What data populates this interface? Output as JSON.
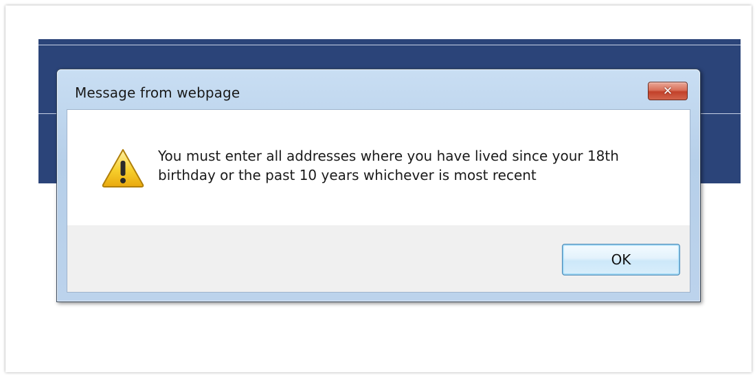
{
  "dialog": {
    "title": "Message from webpage",
    "message": "You must enter all addresses where you have lived since your 18th birthday or the past 10 years whichever is most recent",
    "ok_label": "OK",
    "icon": "warning-icon",
    "close_icon": "close-icon"
  },
  "colors": {
    "page_banner": "#2b4479",
    "close_button": "#c7432c",
    "warning_yellow": "#f5c518"
  }
}
